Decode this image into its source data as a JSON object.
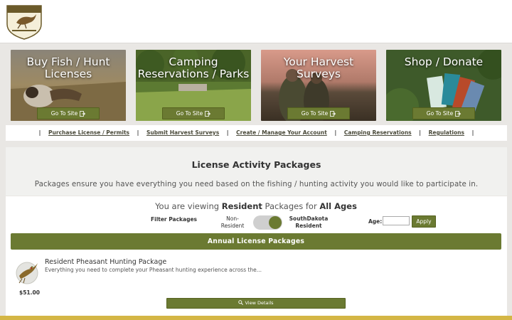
{
  "header": {
    "logo_icon": "south-dakota-gfp-logo",
    "logo_text_top": "SOUTH DAKOTA",
    "logo_text_bottom": "Game, Fish & Parks"
  },
  "tiles": [
    {
      "title": "Buy Fish / Hunt Licenses",
      "button": "Go To Site"
    },
    {
      "title": "Camping Reservations / Parks",
      "button": "Go To Site"
    },
    {
      "title": "Your Harvest Surveys",
      "button": "Go To Site"
    },
    {
      "title": "Shop / Donate",
      "button": "Go To Site"
    }
  ],
  "nav": {
    "separator": "|",
    "links": [
      "Purchase License / Permits",
      "Submit Harvest Surveys",
      "Create / Manage Your Account",
      "Camping Reservations",
      "Regulations"
    ]
  },
  "panel": {
    "title": "License Activity Packages",
    "subtitle": "Packages ensure you have everything you need based on the fishing / hunting activity you would like to participate in."
  },
  "viewing": {
    "prefix": "You are viewing",
    "residency": "Resident",
    "middle": "Packages for",
    "ages": "All Ages"
  },
  "filter": {
    "label": "Filter Packages",
    "non_resident": "Non-Resident",
    "sd_resident": "SouthDakota Resident",
    "age_label": "Age:",
    "age_value": "",
    "apply": "Apply"
  },
  "section": {
    "title": "Annual License Packages"
  },
  "package": {
    "title": "Resident Pheasant Hunting Package",
    "description": "Everything you need to complete your Pheasant hunting experience across the...",
    "price": "$51.00",
    "view_label": "View Details",
    "icon": "pheasant-icon"
  },
  "colors": {
    "accent": "#6b7a32",
    "footer": "#d4b645",
    "background": "#e9e7e4"
  }
}
